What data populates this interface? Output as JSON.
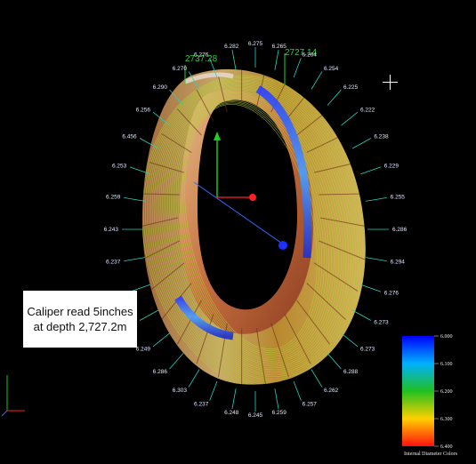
{
  "viewer": {
    "depth_top": "2737.28",
    "depth_top_right": "2727.14",
    "caption_line1": "Caliper read 5inches",
    "caption_line2": "at depth 2,727.2m"
  },
  "radius_labels": [
    "6.275",
    "6.265",
    "6.264",
    "6.254",
    "6.225",
    "6.222",
    "6.238",
    "6.229",
    "6.255",
    "6.286",
    "6.294",
    "6.276",
    "6.273",
    "6.273",
    "6.288",
    "6.262",
    "6.257",
    "6.259",
    "6.245",
    "6.248",
    "6.237",
    "6.303",
    "6.286",
    "6.249",
    "6.466",
    "6.242",
    "6.237",
    "6.243",
    "6.259",
    "6.253",
    "6.456",
    "6.256",
    "6.290",
    "6.270",
    "6.276",
    "6.282"
  ],
  "legend": {
    "title": "Internal Diameter Colors",
    "ticks": [
      "6.000",
      "6.100",
      "6.200",
      "6.300",
      "6.400"
    ],
    "colors": [
      "#ff1010",
      "#ffd000",
      "#20c020",
      "#00b0ff",
      "#0000ff"
    ]
  },
  "icons": {
    "crosshair": "crosshair-icon",
    "axes": "axis-triad-icon"
  }
}
